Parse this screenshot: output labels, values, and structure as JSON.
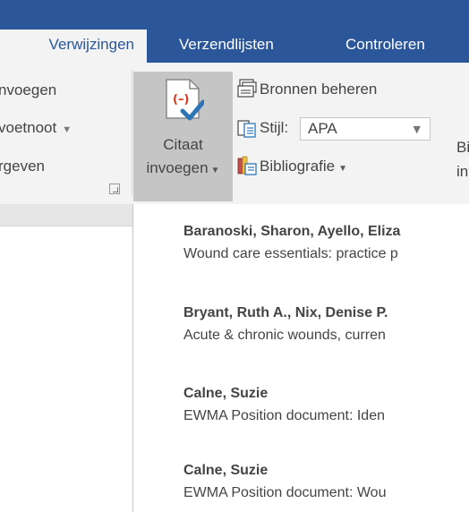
{
  "tabs": [
    {
      "label": "Verwijzingen",
      "active": true
    },
    {
      "label": "Verzendlijsten",
      "active": false
    },
    {
      "label": "Controleren",
      "active": false
    }
  ],
  "footnotes_group": {
    "insert": "nvoegen",
    "next_footnote": "voetnoot",
    "show": "rgeven"
  },
  "citations_group": {
    "insert_citation_line1": "Citaat",
    "insert_citation_line2": "invoegen",
    "manage_sources": "Bronnen beheren",
    "style_label": "Stijl:",
    "style_value": "APA",
    "bibliography": "Bibliografie"
  },
  "captions_group": {
    "partial_line1": "Bi",
    "partial_line2": "in"
  },
  "sources": [
    {
      "author": "Baranoski, Sharon,  Ayello, Eliza",
      "title": "Wound care essentials: practice p"
    },
    {
      "author": "Bryant, Ruth A.,  Nix, Denise P.",
      "title": "Acute & chronic wounds, curren"
    },
    {
      "author": "Calne, Suzie",
      "title": "EWMA Position document: Iden"
    },
    {
      "author": "Calne, Suzie",
      "title": "EWMA Position document: Wou"
    }
  ],
  "colors": {
    "tab_bar": "#2b579a",
    "ribbon": "#f3f3f3",
    "pressed_button": "#c5c5c5",
    "text": "#444444"
  },
  "icons": {
    "citation": "insert-citation-icon",
    "manage_sources": "manage-sources-icon",
    "style": "style-icon",
    "bibliography": "bibliography-icon"
  }
}
